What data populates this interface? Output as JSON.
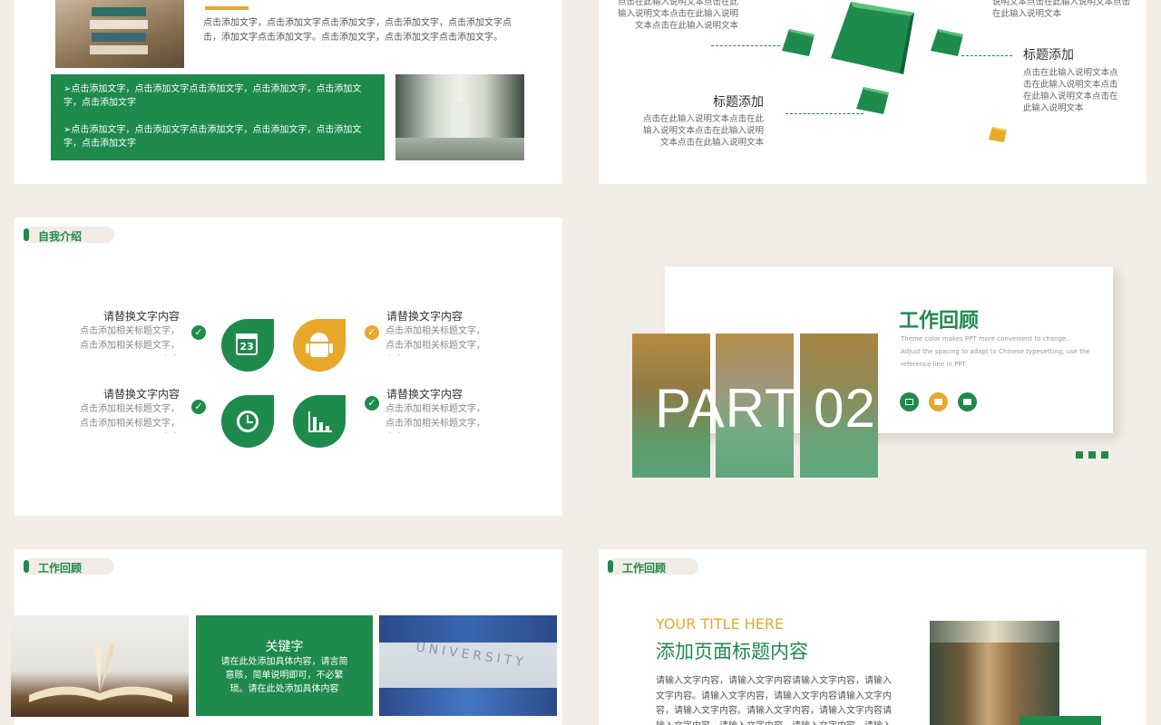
{
  "slide1": {
    "paragraph": "点击添加文字，点击添加文字点击添加文字，点击添加文字，点击添加文字点击，添加文字点击添加文字。点击添加文字，点击添加文字点击添加文字。",
    "bullet1": "➢点击添加文字，点击添加文字点击添加文字，点击添加文字，点击添加文字，点击添加文字",
    "bullet2": "➢点击添加文字，点击添加文字点击添加文字，点击添加文字，点击添加文字，点击添加文字"
  },
  "slide2": {
    "topleft_text": "点击在此输入说明文本点击在此输入说明文本点击在此输入说明文本点击在此输入说明文本",
    "topright_text": "说明文本点击在此输入说明文本点击在此输入说明文本",
    "heading_right": "标题添加",
    "text_right": "点击在此输入说明文本点击在此输入说明文本点击在此输入说明文本点击在此输入说明文本",
    "heading_left": "标题添加",
    "text_left": "点击在此输入说明文本点击在此输入说明文本点击在此输入说明文本点击在此输入说明文本"
  },
  "slide3": {
    "tag": "自我介绍",
    "items": [
      {
        "title": "请替换文字内容",
        "desc": "点击添加相关标题文字，点击添加相关标题文字，点击"
      },
      {
        "title": "请替换文字内容",
        "desc": "点击添加相关标题文字，点击添加相关标题文字，点击"
      },
      {
        "title": "请替换文字内容",
        "desc": "点击添加相关标题文字，点击添加相关标题文字，点击"
      },
      {
        "title": "请替换文字内容",
        "desc": "点击添加相关标题文字，点击添加相关标题文字，点击"
      }
    ],
    "calendar_number": "23"
  },
  "slide4": {
    "part": "PART 02",
    "title": "工作回顾",
    "desc1": "Theme  color makes PPT more convenient to change.",
    "desc2": "Adjust the spacing to adapt to Chinese typesetting, use the",
    "desc3": "reference line in PPT."
  },
  "slide5": {
    "tag": "工作回顾",
    "keyword": "关键字",
    "keyword_desc": "请在此处添加具体内容，请言简意赅，简单说明即可，不必繁琐。请在此处添加具体内容",
    "university": "UNIVERSITY"
  },
  "slide6": {
    "tag": "工作回顾",
    "en_title": "YOUR TITLE HERE",
    "cn_title": "添加页面标题内容",
    "body": "请输入文字内容，请输入文字内容请输入文字内容，请输入文字内容。请输入文字内容，请输入文字内容请输入文字内容，请输入文字内容。请输入文字内容，请输入文字内容请输入文字内容，请输入文字内容。请输入文字内容，请输入文字内容请输入文字内容"
  },
  "colors": {
    "green": "#1e8a4c",
    "yellow": "#e8a82a",
    "background": "#f2ede6"
  }
}
